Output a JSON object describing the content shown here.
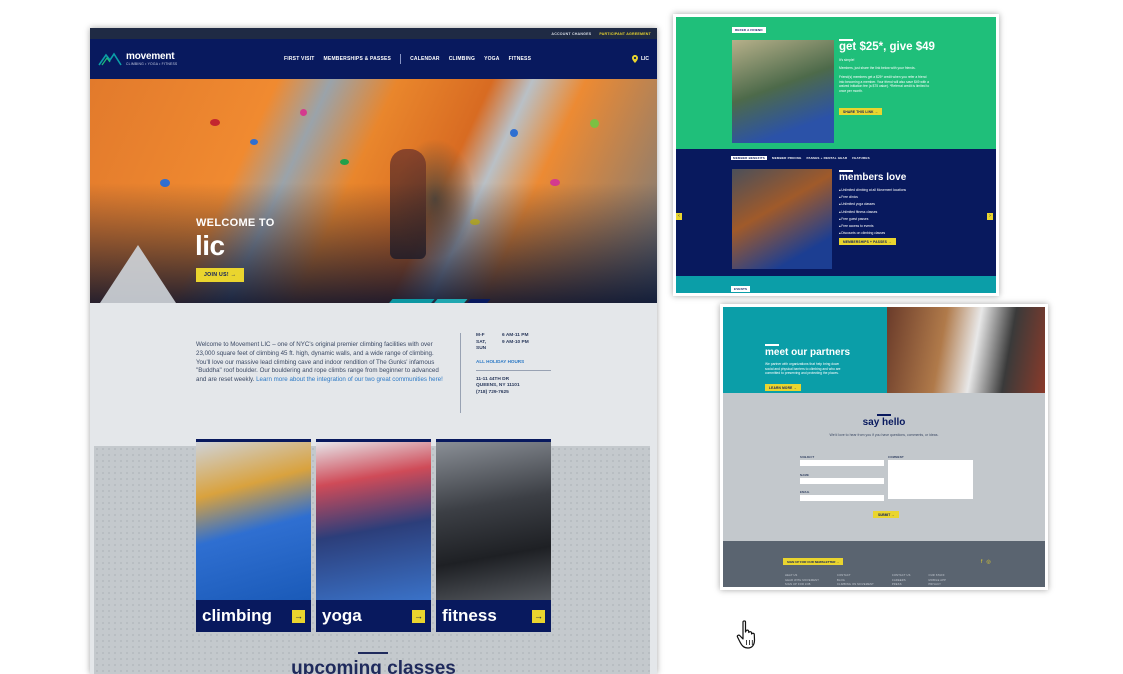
{
  "topbar": {
    "account_changes": "ACCOUNT CHANGES",
    "participant_agreement": "PARTICIPANT AGREEMENT"
  },
  "brand": {
    "name": "movement",
    "tagline": "CLIMBING • YOGA • FITNESS"
  },
  "nav": {
    "items": [
      "FIRST VISIT",
      "MEMBERSHIPS & PASSES",
      "CALENDAR",
      "CLIMBING",
      "YOGA",
      "FITNESS"
    ],
    "location": "LIC"
  },
  "hero": {
    "welcome": "WELCOME TO",
    "location": "lic",
    "cta": "JOIN US! →"
  },
  "intro": {
    "text": "Welcome to Movement LIC – one of NYC's original premier climbing facilities with over 23,000 square feet of climbing 45 ft. high, dynamic walls, and a wide range of climbing. You'll love our massive lead climbing cave and indoor rendition of The Gunks' infamous \"Buddha\" roof boulder. Our bouldering and rope climbs range from beginner to advanced and are reset weekly. ",
    "link": "Learn more about the integration of our two great communities here!"
  },
  "hours": {
    "rows": [
      {
        "days": "M-F",
        "time": "6 AM-11 PM"
      },
      {
        "days": "SAT, SUN",
        "time": "9 AM-10 PM"
      }
    ],
    "holiday_link": "ALL HOLIDAY HOURS",
    "address_line1": "11-11 44TH DR",
    "address_line2": "QUEENS, NY 11101",
    "phone": "(718) 729-7625"
  },
  "cards": [
    {
      "label": "climbing",
      "arrow": "→"
    },
    {
      "label": "yoga",
      "arrow": "→"
    },
    {
      "label": "fitness",
      "arrow": "→"
    }
  ],
  "upcoming": {
    "title": "upcoming classes"
  },
  "refer": {
    "tag": "REFER A FRIEND",
    "title": "get $25*, give $49",
    "line1": "It's simple!",
    "line2": "Members, just share the link below with your friends.",
    "line3": "Friend(s) members get a $25* credit when you refer a friend into becoming a member. Your friend will also save $49 with a waived initiation fee (a $75 value). *Referral credit is limited to once per month.",
    "button": "SHARE THIS LINK →"
  },
  "members": {
    "tabs": [
      "MEMBER BENEFITS",
      "MEMBER PRICING",
      "PASSES + RENTAL GEAR",
      "FEATURES"
    ],
    "title": "members love",
    "benefits": [
      "Unlimited climbing at all Movement locations",
      "Free clinics",
      "Unlimited yoga classes",
      "Unlimited fitness classes",
      "Free guest passes",
      "Free access to events",
      "Discounts on climbing classes",
      "Discounts on gear and apparel"
    ],
    "button": "MEMBERSHIPS + PASSES →",
    "arrow_left": "‹",
    "arrow_right": "›",
    "footer_tag": "EVENTS"
  },
  "partners": {
    "title": "meet our partners",
    "text": "We partner with organizations that help bring down social and physical barriers to climbing and who are committed to preserving and protecting the places.",
    "button": "LEARN MORE →"
  },
  "contact": {
    "title": "say hello",
    "subtitle": "We'd love to hear from you if you have questions, comments, or ideas.",
    "fields": [
      "SUBJECT",
      "NAME",
      "EMAIL"
    ],
    "comment_label": "COMMENT",
    "submit": "SUBMIT →"
  },
  "footer": {
    "newsletter": "SIGN UP FOR OUR NEWSLETTER →",
    "col1": [
      "HELP US",
      "GEAR WITH MOVEMENT",
      "SIGN UP FOR JOB"
    ],
    "col2": [
      "CONTACT",
      "BLOG",
      "CLIMBING ON MOVEMENT"
    ],
    "col3": [
      "CONTACT US",
      "CAREERS",
      "PRESS"
    ],
    "col4": [
      "OUR STAFF",
      "MOBILE APP",
      "PRIVACY"
    ],
    "social": [
      "f",
      "◎"
    ]
  },
  "colors": {
    "navy": "#08195e",
    "yellow": "#ead52e",
    "teal": "#0b9ea8",
    "green": "#1fbf7a",
    "gray": "#c3c8cc"
  }
}
